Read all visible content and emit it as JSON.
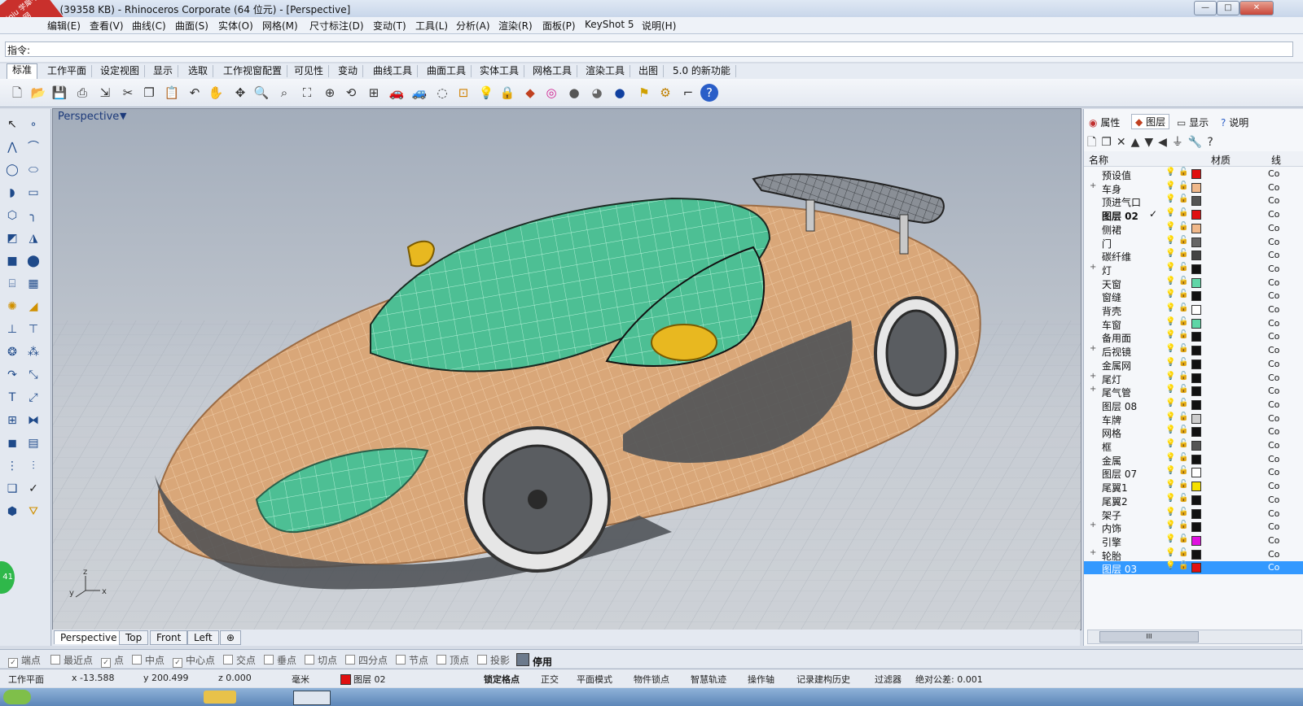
{
  "window": {
    "title": "m (39358 KB) - Rhinoceros Corporate (64 位元) - [Perspective]",
    "watermark": "xuexiniu 学犀牛中文网",
    "minimize": "—",
    "maximize": "□",
    "close": "✕"
  },
  "menu": [
    "编辑(E)",
    "查看(V)",
    "曲线(C)",
    "曲面(S)",
    "实体(O)",
    "网格(M)",
    "尺寸标注(D)",
    "变动(T)",
    "工具(L)",
    "分析(A)",
    "渲染(R)",
    "面板(P)",
    "KeyShot 5",
    "说明(H)"
  ],
  "command": {
    "label": "指令:",
    "value": ""
  },
  "toolbar_tabs": [
    "标准",
    "工作平面",
    "设定视图",
    "显示",
    "选取",
    "工作视窗配置",
    "可见性",
    "变动",
    "曲线工具",
    "曲面工具",
    "实体工具",
    "网格工具",
    "渲染工具",
    "出图",
    "5.0 的新功能"
  ],
  "toolbar_icons": [
    "new-icon",
    "open-icon",
    "save-icon",
    "print-icon",
    "import-icon",
    "cut-icon",
    "copy-icon",
    "paste-icon",
    "undo-icon",
    "pan-hand-icon",
    "move-view-icon",
    "zoom-icon",
    "zoom-window-icon",
    "zoom-extents-icon",
    "zoom-selected-icon",
    "rotate-view-icon",
    "viewport-layout-icon",
    "car-icon",
    "car-icon",
    "circle-icon",
    "grid-icon",
    "light-icon",
    "lock-icon",
    "layer-icon",
    "color-wheel-icon",
    "sphere-icon",
    "sphere-icon",
    "sphere-blue-icon",
    "flag-icon",
    "gear-icon",
    "snap-icon",
    "help-icon"
  ],
  "viewport": {
    "name": "Perspective",
    "dropdown": "▼",
    "axis_x": "x",
    "axis_y": "y",
    "axis_z": "z"
  },
  "view_tabs": [
    "Perspective",
    "Top",
    "Front",
    "Left",
    "⊕"
  ],
  "osnap": [
    {
      "label": "端点",
      "checked": true
    },
    {
      "label": "最近点",
      "checked": false
    },
    {
      "label": "点",
      "checked": true
    },
    {
      "label": "中点",
      "checked": false
    },
    {
      "label": "中心点",
      "checked": true
    },
    {
      "label": "交点",
      "checked": false
    },
    {
      "label": "垂点",
      "checked": false
    },
    {
      "label": "切点",
      "checked": false
    },
    {
      "label": "四分点",
      "checked": false
    },
    {
      "label": "节点",
      "checked": false
    },
    {
      "label": "顶点",
      "checked": false
    },
    {
      "label": "投影",
      "checked": false
    },
    {
      "label": "停用",
      "checked": true
    }
  ],
  "status": {
    "cplane": "工作平面",
    "x": "x -13.588",
    "y": "y 200.499",
    "z": "z 0.000",
    "units": "毫米",
    "layer": "图层 02",
    "grid_snap": "锁定格点",
    "ortho": "正交",
    "planar": "平面模式",
    "osnap": "物件锁点",
    "smarttrack": "智慧轨迹",
    "gumball": "操作轴",
    "history": "记录建构历史",
    "filter": "过滤器",
    "tolerance": "绝对公差: 0.001",
    "layer_color": "#e01010"
  },
  "panel": {
    "tabs": [
      "属性",
      "图层",
      "显示",
      "说明"
    ],
    "col_name": "名称",
    "col_material": "材质",
    "col_extra": "线",
    "scroll_mark": "III"
  },
  "layers": [
    {
      "name": "预设值",
      "expand": "",
      "color": "#e01010",
      "current": false,
      "selected": false
    },
    {
      "name": "车身",
      "expand": "+",
      "color": "#f0b88a",
      "current": false,
      "selected": false
    },
    {
      "name": "顶进气口",
      "expand": "",
      "color": "#555555",
      "current": false,
      "selected": false
    },
    {
      "name": "图层 02",
      "expand": "",
      "color": "#e01010",
      "current": true,
      "selected": false
    },
    {
      "name": "侧裙",
      "expand": "",
      "color": "#f0b88a",
      "current": false,
      "selected": false
    },
    {
      "name": "门",
      "expand": "",
      "color": "#666666",
      "current": false,
      "selected": false
    },
    {
      "name": "碳纤维",
      "expand": "",
      "color": "#444444",
      "current": false,
      "selected": false
    },
    {
      "name": "灯",
      "expand": "+",
      "color": "#111111",
      "current": false,
      "selected": false
    },
    {
      "name": "天窗",
      "expand": "",
      "color": "#5fd6a7",
      "current": false,
      "selected": false
    },
    {
      "name": "窗缝",
      "expand": "",
      "color": "#111111",
      "current": false,
      "selected": false
    },
    {
      "name": "背壳",
      "expand": "",
      "color": "#ffffff",
      "current": false,
      "selected": false
    },
    {
      "name": "车窗",
      "expand": "",
      "color": "#5fd6a7",
      "current": false,
      "selected": false
    },
    {
      "name": "备用面",
      "expand": "",
      "color": "#111111",
      "current": false,
      "selected": false
    },
    {
      "name": "后视镜",
      "expand": "+",
      "color": "#111111",
      "current": false,
      "selected": false
    },
    {
      "name": "金属网",
      "expand": "",
      "color": "#111111",
      "current": false,
      "selected": false
    },
    {
      "name": "尾灯",
      "expand": "+",
      "color": "#111111",
      "current": false,
      "selected": false
    },
    {
      "name": "尾气管",
      "expand": "+",
      "color": "#111111",
      "current": false,
      "selected": false
    },
    {
      "name": "图层 08",
      "expand": "",
      "color": "#111111",
      "current": false,
      "selected": false
    },
    {
      "name": "车牌",
      "expand": "",
      "color": "#cccccc",
      "current": false,
      "selected": false
    },
    {
      "name": "网格",
      "expand": "",
      "color": "#111111",
      "current": false,
      "selected": false
    },
    {
      "name": "框",
      "expand": "",
      "color": "#555555",
      "current": false,
      "selected": false
    },
    {
      "name": "金属",
      "expand": "",
      "color": "#111111",
      "current": false,
      "selected": false
    },
    {
      "name": "图层 07",
      "expand": "",
      "color": "#ffffff",
      "current": false,
      "selected": false
    },
    {
      "name": "尾翼1",
      "expand": "",
      "color": "#f5e000",
      "current": false,
      "selected": false
    },
    {
      "name": "尾翼2",
      "expand": "",
      "color": "#111111",
      "current": false,
      "selected": false
    },
    {
      "name": "架子",
      "expand": "",
      "color": "#111111",
      "current": false,
      "selected": false
    },
    {
      "name": "内饰",
      "expand": "+",
      "color": "#111111",
      "current": false,
      "selected": false
    },
    {
      "name": "引擎",
      "expand": "",
      "color": "#e010e0",
      "current": false,
      "selected": false
    },
    {
      "name": "轮胎",
      "expand": "+",
      "color": "#111111",
      "current": false,
      "selected": false
    },
    {
      "name": "图层 03",
      "expand": "",
      "color": "#e01010",
      "current": false,
      "selected": true
    }
  ],
  "layer_material_text": "Co",
  "current_mark": "✓",
  "badge": "41"
}
